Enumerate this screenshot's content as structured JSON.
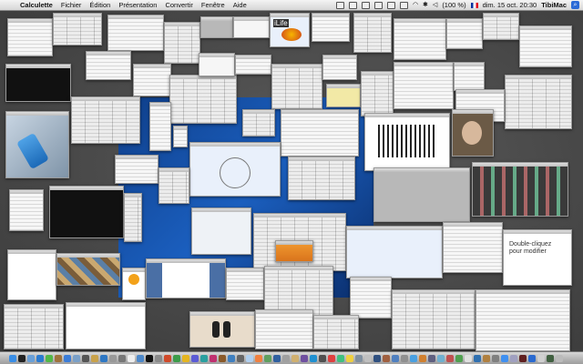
{
  "menubar": {
    "app_name": "Calculette",
    "items": [
      "Fichier",
      "Édition",
      "Présentation",
      "Convertir",
      "Fenêtre",
      "Aide"
    ],
    "battery": "(100 %)",
    "clock": "dim. 15 oct. 20:30",
    "user": "TibiMac"
  },
  "windows": {
    "ilife_label": "iLife",
    "double_click_text": "Double-cliquez pour modifier"
  },
  "colors": {
    "wallpaper": "#0f3f8a",
    "desktop": "#4a4a4a"
  }
}
